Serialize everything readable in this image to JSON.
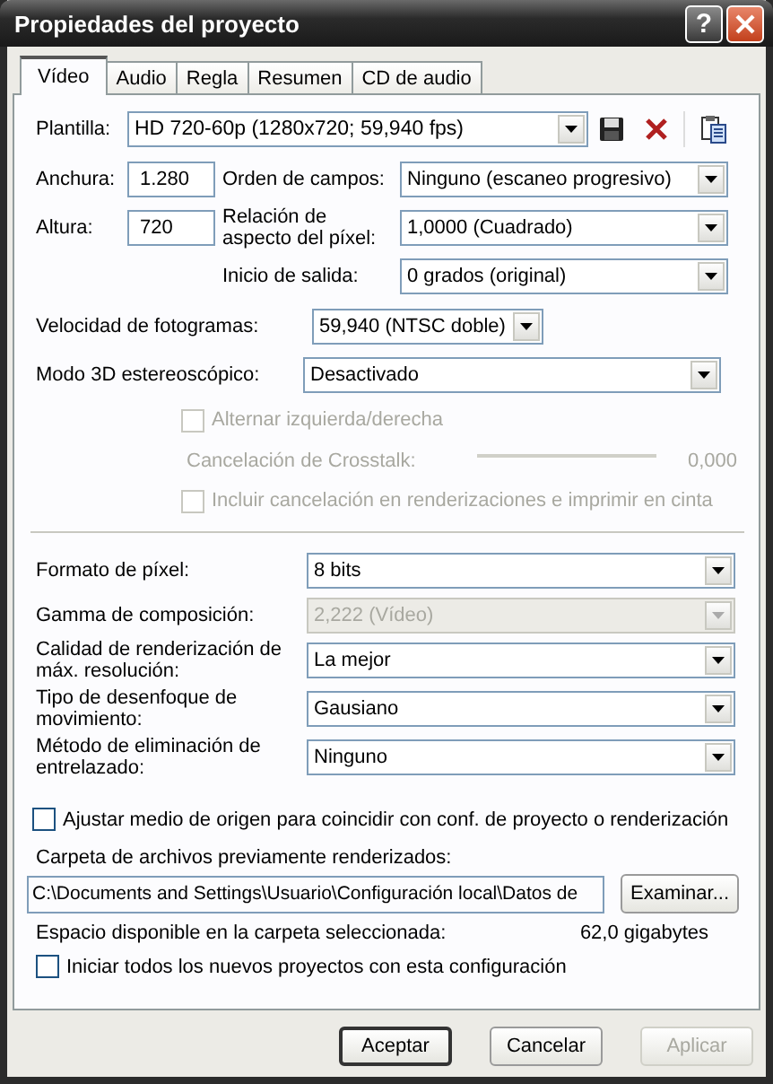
{
  "window": {
    "title": "Propiedades del proyecto",
    "help": "?"
  },
  "tabs": [
    {
      "label": "Vídeo",
      "selected": true
    },
    {
      "label": "Audio",
      "selected": false
    },
    {
      "label": "Regla",
      "selected": false
    },
    {
      "label": "Resumen",
      "selected": false
    },
    {
      "label": "CD de audio",
      "selected": false
    }
  ],
  "template": {
    "label": "Plantilla:",
    "value": "HD 720-60p (1280x720; 59,940 fps)"
  },
  "size_fields": [
    {
      "label": "Anchura:",
      "value": "1.280"
    },
    {
      "label": "Altura:",
      "value": "720"
    }
  ],
  "format_dropdowns": [
    {
      "label": "Orden de campos:",
      "value": "Ninguno (escaneo progresivo)"
    },
    {
      "label": "Relación de aspecto del píxel:",
      "value": "1,0000 (Cuadrado)"
    },
    {
      "label": "Inicio de salida:",
      "value": "0 grados (original)"
    }
  ],
  "frame_rate": {
    "label": "Velocidad de fotogramas:",
    "value": "59,940 (NTSC doble)"
  },
  "stereo_3d": {
    "label": "Modo 3D estereoscópico:",
    "value": "Desactivado"
  },
  "stereo_options": [
    {
      "kind": "checkbox",
      "label": "Alternar izquierda/derecha",
      "checked": false,
      "disabled": true
    },
    {
      "kind": "slider",
      "label": "Cancelación de Crosstalk:",
      "level": 0,
      "reading": "0,000",
      "disabled": true
    },
    {
      "kind": "checkbox",
      "label": "Incluir cancelación en renderizaciones e imprimir en cinta",
      "checked": false,
      "disabled": true
    }
  ],
  "render_settings": [
    {
      "label": "Formato de píxel:",
      "value": "8 bits",
      "disabled": false
    },
    {
      "label": "Gamma de composición:",
      "value": "2,222 (Vídeo)",
      "disabled": true
    },
    {
      "label": "Calidad de renderización de máx. resolución:",
      "value": "La mejor",
      "disabled": false
    },
    {
      "label": "Tipo de desenfoque de movimiento:",
      "value": "Gausiano",
      "disabled": false
    },
    {
      "label": "Método de eliminación de entrelazado:",
      "value": "Ninguno",
      "disabled": false
    }
  ],
  "match_media": {
    "label": "Ajustar medio de origen para coincidir con conf. de proyecto o renderización",
    "checked": false
  },
  "render_folder": {
    "label": "Carpeta de archivos previamente renderizados:",
    "value": "C:\\Documents and Settings\\Usuario\\Configuración local\\Datos de",
    "button": "Examinar..."
  },
  "free_space": {
    "label": "Espacio disponible en la carpeta seleccionada:",
    "value": "62,0 gigabytes"
  },
  "start_all": {
    "label": "Iniciar todos los nuevos proyectos con esta configuración",
    "checked": false
  },
  "buttons": [
    {
      "label": "Aceptar",
      "default": true,
      "disabled": false
    },
    {
      "label": "Cancelar",
      "default": false,
      "disabled": false
    },
    {
      "label": "Aplicar",
      "default": false,
      "disabled": true
    }
  ]
}
